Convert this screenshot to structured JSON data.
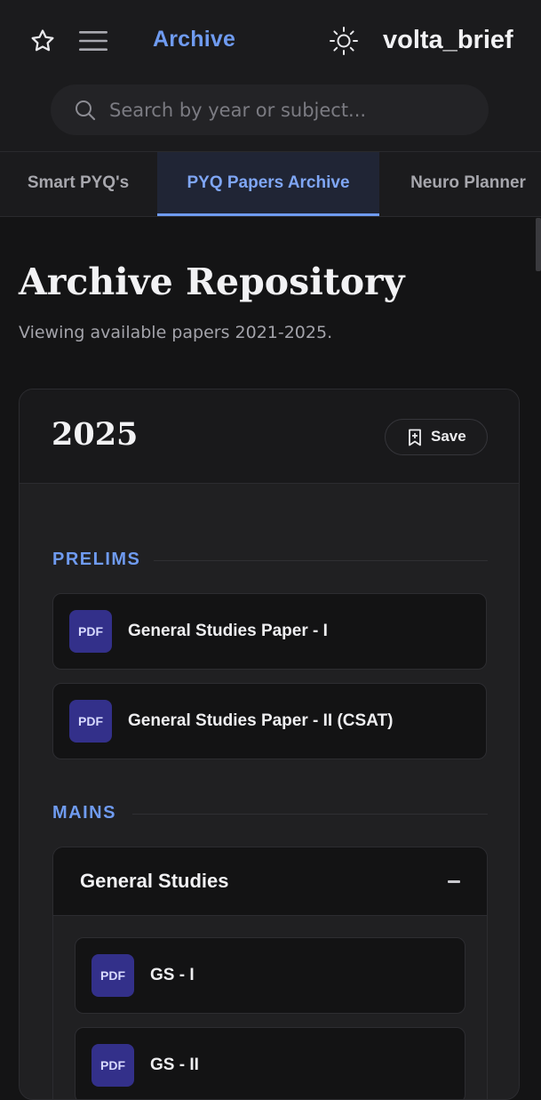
{
  "header": {
    "brand_section": "Archive",
    "brand_name": "volta_brief",
    "search_placeholder": "Search by year or subject..."
  },
  "tabs": [
    {
      "label": "Smart PYQ's",
      "active": false
    },
    {
      "label": "PYQ Papers Archive",
      "active": true
    },
    {
      "label": "Neuro Planner",
      "active": false
    }
  ],
  "page": {
    "title": "Archive Repository",
    "subtitle": "Viewing available papers 2021-2025."
  },
  "year_card": {
    "year": "2025",
    "save_label": "Save",
    "prelims": {
      "label": "PRELIMS",
      "papers": [
        {
          "badge": "PDF",
          "title": "General Studies Paper - I"
        },
        {
          "badge": "PDF",
          "title": "General Studies Paper - II (CSAT)"
        }
      ]
    },
    "mains": {
      "label": "MAINS",
      "group": {
        "title": "General Studies",
        "papers": [
          {
            "badge": "PDF",
            "title": "GS - I"
          },
          {
            "badge": "PDF",
            "title": "GS - II"
          }
        ]
      }
    }
  },
  "colors": {
    "accent": "#6f9bf0",
    "pdf_badge": "#33308a",
    "background": "#141415"
  }
}
